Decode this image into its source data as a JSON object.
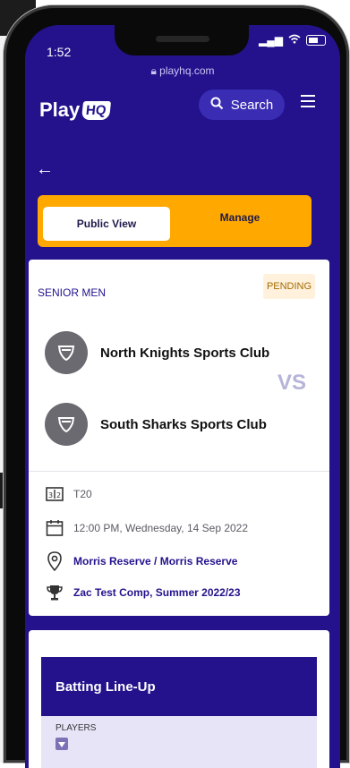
{
  "status": {
    "time": "1:52"
  },
  "browser": {
    "url": "playhq.com"
  },
  "header": {
    "logo_part1": "Play",
    "logo_part2": "HQ",
    "search_label": "Search"
  },
  "toggle": {
    "public_view": "Public View",
    "manage": "Manage"
  },
  "match": {
    "category": "SENIOR MEN",
    "status": "PENDING",
    "home_team": "North Knights Sports Club",
    "away_team": "South Sharks Sports Club",
    "vs": "VS",
    "format": "T20",
    "datetime": "12:00 PM, Wednesday, 14 Sep 2022",
    "venue": "Morris Reserve / Morris Reserve",
    "competition": "Zac Test Comp, Summer 2022/23"
  },
  "lineup": {
    "title": "Batting Line-Up",
    "players_label": "PLAYERS"
  },
  "colors": {
    "brand_navy": "#23128c",
    "accent_orange": "#ffa800",
    "pending_bg": "#fff1dc"
  }
}
